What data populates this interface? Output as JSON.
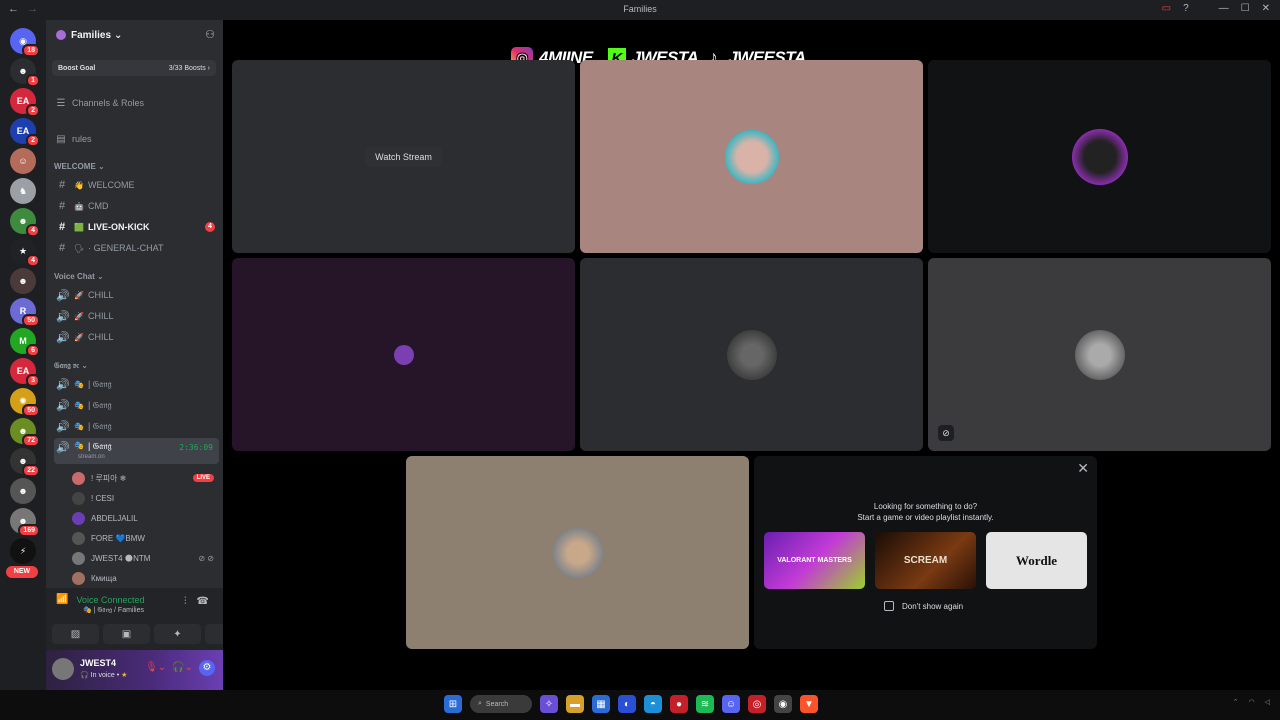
{
  "window": {
    "title": "Families",
    "back_icon": "←",
    "forward_icon": "→"
  },
  "rail": {
    "servers": [
      {
        "name": "home",
        "color": "#5865f2",
        "glyph": "◉",
        "badge": "18"
      },
      {
        "name": "s1",
        "color": "#2b2d31",
        "glyph": "☻",
        "badge": "1"
      },
      {
        "name": "ea1",
        "color": "#d6283c",
        "glyph": "EA",
        "badge": "2"
      },
      {
        "name": "ea2",
        "color": "#1e40af",
        "glyph": "EA",
        "badge": "2"
      },
      {
        "name": "s4",
        "color": "#b56b5a",
        "glyph": "☺",
        "badge": ""
      },
      {
        "name": "s5",
        "color": "#9aa0a6",
        "glyph": "♞",
        "badge": ""
      },
      {
        "name": "s6",
        "color": "#3d8b3d",
        "glyph": "☻",
        "badge": "4"
      },
      {
        "name": "s7",
        "color": "#202225",
        "glyph": "★",
        "badge": "4"
      },
      {
        "name": "s8",
        "color": "#4a3a3a",
        "glyph": "☻",
        "badge": ""
      },
      {
        "name": "s9",
        "color": "#6b6bd6",
        "glyph": "R",
        "badge": "50"
      },
      {
        "name": "s10",
        "color": "#22a722",
        "glyph": "M",
        "badge": "6"
      },
      {
        "name": "ea3",
        "color": "#d6283c",
        "glyph": "EA",
        "badge": "3"
      },
      {
        "name": "s12",
        "color": "#d4a017",
        "glyph": "✺",
        "badge": "50"
      },
      {
        "name": "s13",
        "color": "#6b8e23",
        "glyph": "☻",
        "badge": "72"
      },
      {
        "name": "s14",
        "color": "#333",
        "glyph": "☻",
        "badge": "22"
      },
      {
        "name": "s15",
        "color": "#555",
        "glyph": "☻",
        "badge": ""
      },
      {
        "name": "s16",
        "color": "#777",
        "glyph": "☻",
        "badge": "169"
      },
      {
        "name": "s17",
        "color": "#111",
        "glyph": "⚡",
        "badge": ""
      }
    ],
    "new_label": "NEW"
  },
  "sidebar": {
    "server_name": "Families",
    "boost_goal": "Boost Goal",
    "boost_count": "3/33 Boosts",
    "channels_roles": "Channels & Roles",
    "rules": "rules",
    "cat_welcome": "WELCOME",
    "text_channels": [
      {
        "emoji": "👋",
        "label": "WELCOME",
        "bold": false,
        "mention": ""
      },
      {
        "emoji": "🤖",
        "label": "CMD",
        "bold": false,
        "mention": ""
      },
      {
        "emoji": "🟩",
        "label": "LIVE-ON-KICK",
        "bold": true,
        "mention": "4"
      },
      {
        "emoji": "🗣",
        "label": "· GENERAL-CHAT",
        "bold": false,
        "mention": ""
      }
    ],
    "cat_voice": "Voice Chat",
    "voice_channels": [
      "CHILL",
      "CHILL",
      "CHILL"
    ],
    "cat_gang": "𝔊𝔞𝔫𝔤 𝔳𝔠",
    "gang_channels": [
      "| 𝔊𝔞𝔫𝔤",
      "| 𝔊𝔞𝔫𝔤",
      "| 𝔊𝔞𝔫𝔤"
    ],
    "active_channel": "| 𝔊𝔞𝔫𝔤",
    "active_timer": "2:36:09",
    "active_sub": "stream.on",
    "members": [
      {
        "name": "! 루피아 ❄",
        "tag": "LIVE",
        "color": "#c86b6b"
      },
      {
        "name": "! CESI",
        "tag": "",
        "color": "#444"
      },
      {
        "name": "ABDELJALIL",
        "tag": "",
        "color": "#6b3fb3"
      },
      {
        "name": "FORE 💙BMW",
        "tag": "",
        "color": "#555"
      },
      {
        "name": "JWEST4 🌑NTM",
        "tag": "icons",
        "color": "#777"
      },
      {
        "name": "Кмища",
        "tag": "",
        "color": "#a07060"
      }
    ],
    "voice_connected": "Voice Connected",
    "voice_sub": "🎭 | 𝔊𝔞𝔫𝔤 / Families",
    "user_name": "JWEST4",
    "user_status": "In voice •"
  },
  "stage": {
    "banner": {
      "ig": "4MIINE_",
      "kick": "JWESTA",
      "tiktok": "JWEESTA"
    },
    "watch_stream": "Watch Stream",
    "activity": {
      "line1": "Looking for something to do?",
      "line2": "Start a game or video playlist instantly.",
      "cards": [
        "VALORANT MASTERS",
        "SCREAM",
        "Wordle"
      ],
      "dont_show": "Don't show again"
    }
  },
  "taskbar": {
    "search": "Search"
  }
}
